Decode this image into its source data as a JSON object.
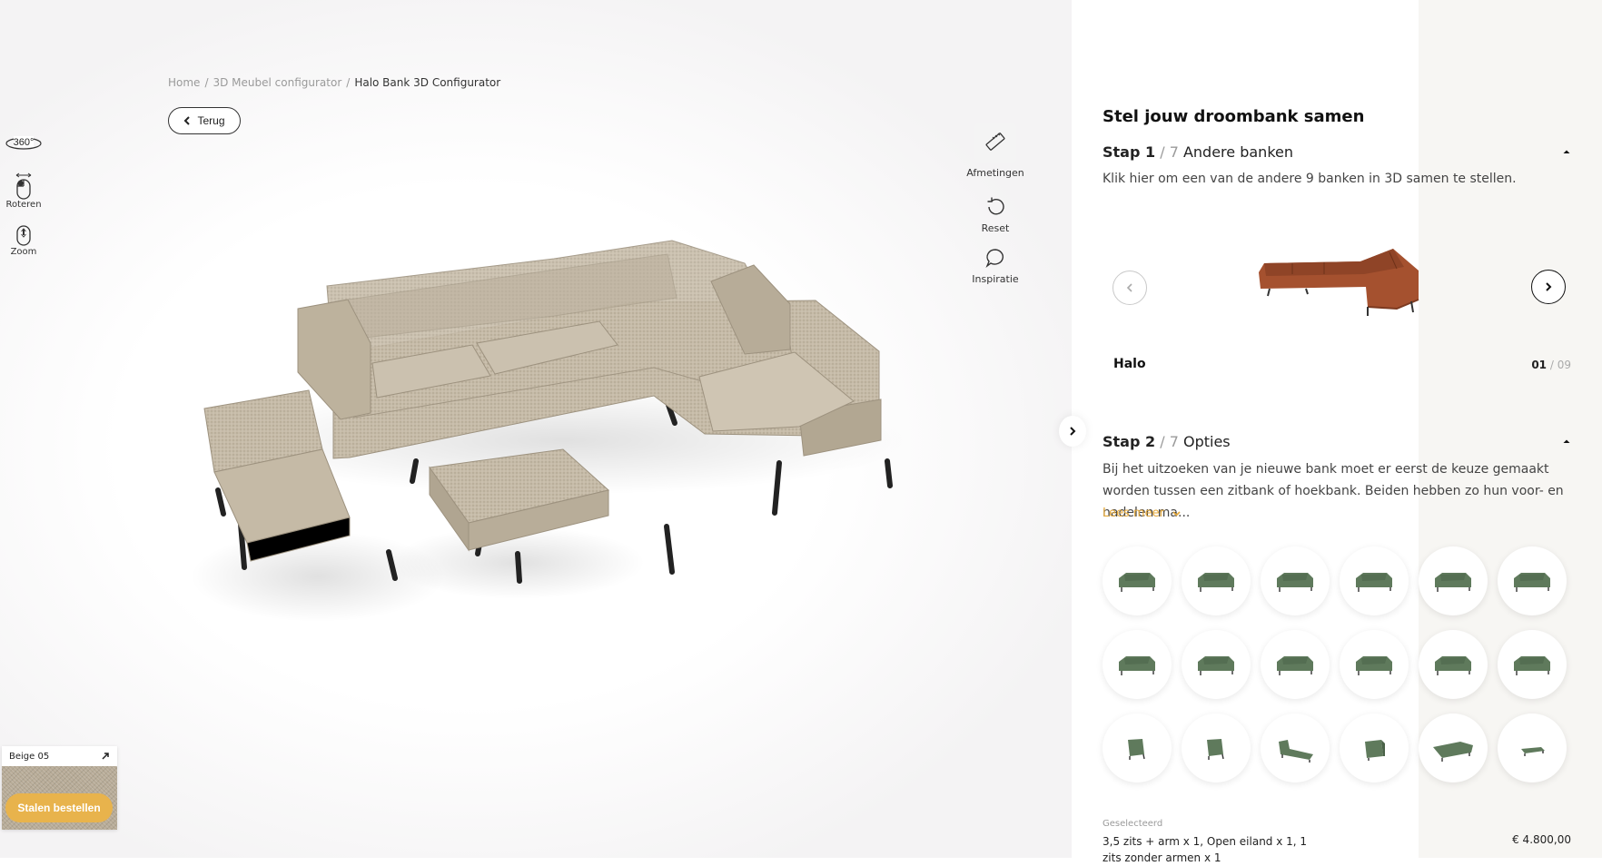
{
  "breadcrumb": {
    "items": [
      "Home",
      "3D Meubel configurator"
    ],
    "separator": "/",
    "current": "Halo Bank 3D Configurator"
  },
  "back_button": {
    "label": "Terug",
    "icon": "chevron-left-icon"
  },
  "viewer_controls": [
    {
      "label": "360°",
      "icon": "rotate-360-icon"
    },
    {
      "label": "Roteren",
      "icon": "mouse-drag-icon"
    },
    {
      "label": "Zoom",
      "icon": "mouse-scroll-icon"
    }
  ],
  "tools": [
    {
      "label": "Afmetingen",
      "icon": "ruler-icon"
    },
    {
      "label": "Reset",
      "icon": "reset-icon"
    },
    {
      "label": "Inspiratie",
      "icon": "chat-bubble-icon"
    }
  ],
  "fabric": {
    "name": "Beige 05",
    "color": "#b7ab97",
    "order_label": "Stalen bestellen"
  },
  "panel": {
    "title": "Stel jouw droombank samen",
    "step1": {
      "label": "Stap 1",
      "total": "/ 7",
      "name": "Andere banken",
      "description": "Klik hier om een van de andere 9 banken in 3D samen te stellen."
    },
    "model": {
      "name": "Halo",
      "index": "01",
      "total": "/ 09",
      "color": "#a5512f"
    },
    "step2": {
      "label": "Stap 2",
      "total": "/ 7",
      "name": "Opties",
      "description": "Bij het uitzoeken van je nieuwe bank moet er eerst de keuze gemaakt worden tussen een zitbank of hoekbank. Beiden hebben zo hun voor- en nadelen ma...",
      "read_more": "Lees meer"
    },
    "options": [
      "sofa-4-seat",
      "sofa-3-5-seat",
      "sofa-3-seat-arm",
      "sofa-3-seat",
      "sofa-4-seat-long",
      "sofa-3-5-seat-b",
      "sofa-3-seat-b",
      "sofa-2-5-seat",
      "sofa-3-seat-c",
      "sofa-2-5-seat-b",
      "sofa-2-seat",
      "sofa-2-seat-arm",
      "chair-armless",
      "chair-arm",
      "chaise-longue",
      "corner-element",
      "open-island",
      "ottoman"
    ],
    "option_color": "#5f7a5c",
    "selected": {
      "label": "Geselecteerd",
      "value": "3,5 zits + arm x 1, Open eiland x 1, 1 zits zonder armen x 1",
      "price": "€ 4.800,00"
    }
  },
  "accent_color": "#e8b34c"
}
